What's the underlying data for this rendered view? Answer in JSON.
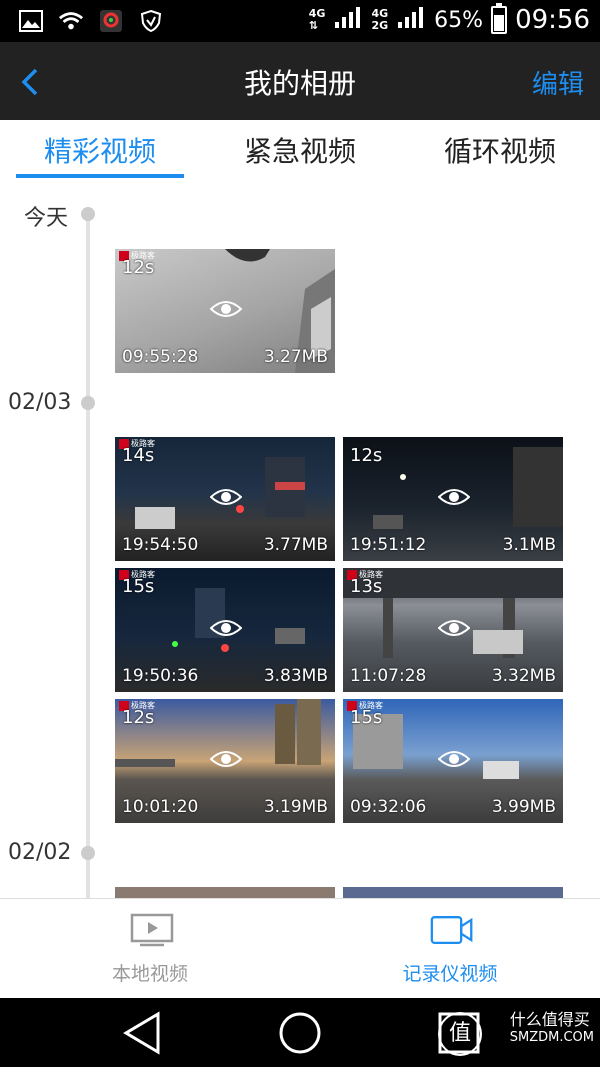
{
  "status_bar": {
    "battery": "65%",
    "time": "09:56",
    "net1": "4G",
    "net2": "4G",
    "net3": "2G"
  },
  "header": {
    "title": "我的相册",
    "edit_label": "编辑"
  },
  "tabs": [
    {
      "label": "精彩视频",
      "active": true
    },
    {
      "label": "紧急视频",
      "active": false
    },
    {
      "label": "循环视频",
      "active": false
    }
  ],
  "groups": [
    {
      "date": "今天",
      "videos": [
        {
          "duration": "12s",
          "time": "09:55:28",
          "size": "3.27MB"
        }
      ]
    },
    {
      "date": "02/03",
      "videos": [
        {
          "duration": "14s",
          "time": "19:54:50",
          "size": "3.77MB"
        },
        {
          "duration": "12s",
          "time": "19:51:12",
          "size": "3.1MB"
        },
        {
          "duration": "15s",
          "time": "19:50:36",
          "size": "3.83MB"
        },
        {
          "duration": "13s",
          "time": "11:07:28",
          "size": "3.32MB"
        },
        {
          "duration": "12s",
          "time": "10:01:20",
          "size": "3.19MB"
        },
        {
          "duration": "15s",
          "time": "09:32:06",
          "size": "3.99MB"
        }
      ]
    },
    {
      "date": "02/02",
      "videos": []
    }
  ],
  "thumb_brand": "极路客",
  "bottom_nav": [
    {
      "label": "本地视频",
      "active": false
    },
    {
      "label": "记录仪视频",
      "active": true
    }
  ],
  "watermark": {
    "line1": "什么值得买",
    "line2": "SMZDM.COM",
    "glyph": "值"
  },
  "colors": {
    "accent": "#1d8ef0",
    "header_bg": "#222222"
  }
}
